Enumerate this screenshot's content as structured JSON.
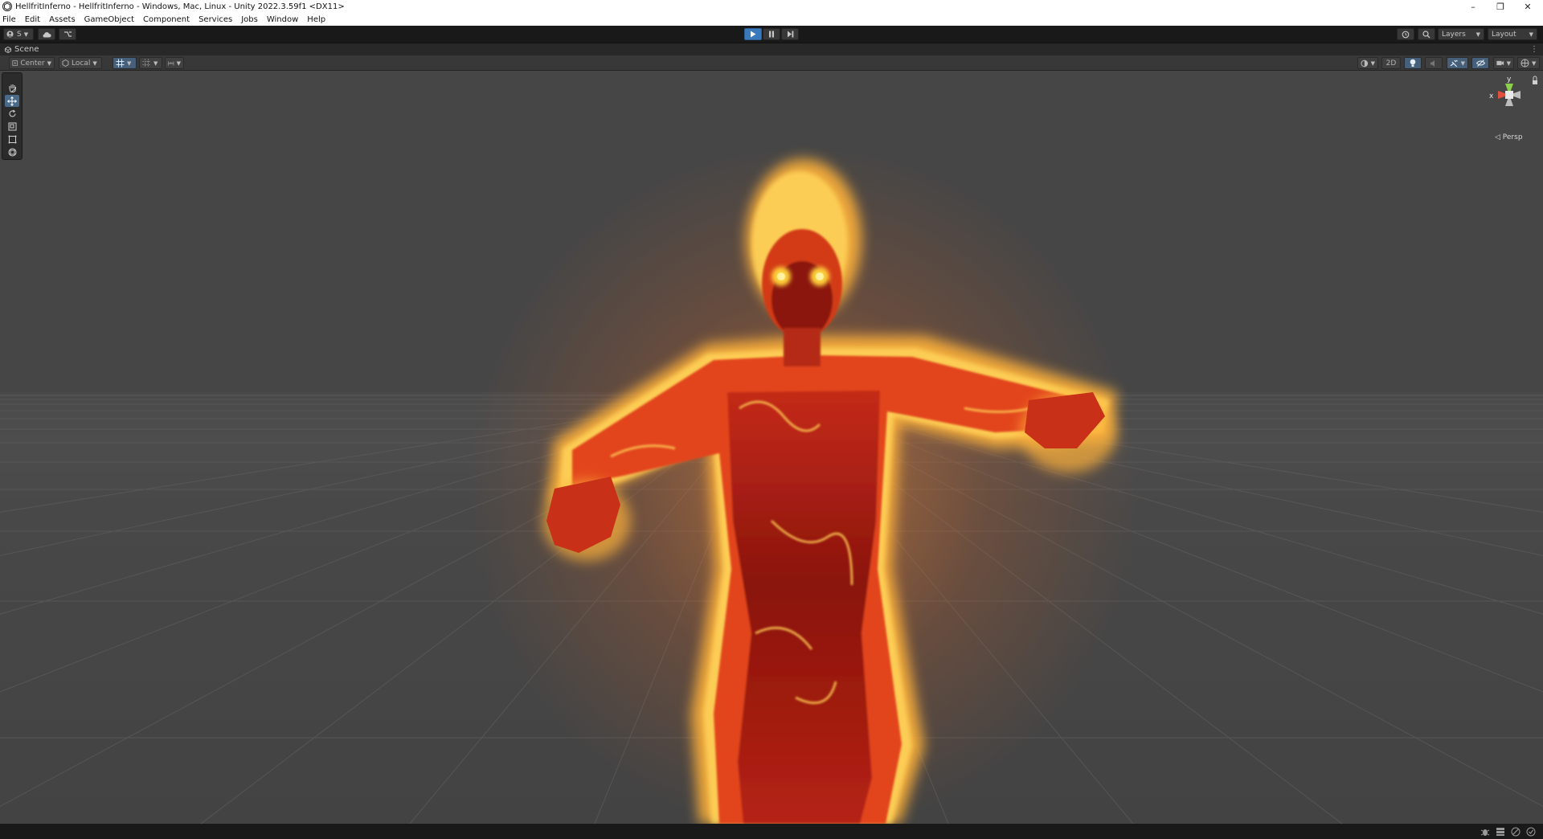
{
  "window": {
    "title": "HellfritInferno - HellfritInferno - Windows, Mac, Linux - Unity 2022.3.59f1 <DX11>",
    "minimize_glyph": "–",
    "maximize_glyph": "❐",
    "close_glyph": "✕"
  },
  "menu": [
    "File",
    "Edit",
    "Assets",
    "GameObject",
    "Component",
    "Services",
    "Jobs",
    "Window",
    "Help"
  ],
  "toolbar": {
    "account_label": "S",
    "layers_label": "Layers",
    "layout_label": "Layout",
    "accent_color": "#3a79bb"
  },
  "scene_tab": {
    "label": "Scene"
  },
  "scene_toolbar": {
    "pivot_label": "Center",
    "space_label": "Local",
    "mode_2d_label": "2D"
  },
  "gizmo": {
    "x_label": "x",
    "y_label": "y",
    "projection_label": "◁ Persp"
  },
  "colors": {
    "fire_core": "#8a1410",
    "fire_mid": "#e2451a",
    "fire_glow": "#ffd45a",
    "eyes": "#fff2a0",
    "grid": "#5a5a5a"
  }
}
